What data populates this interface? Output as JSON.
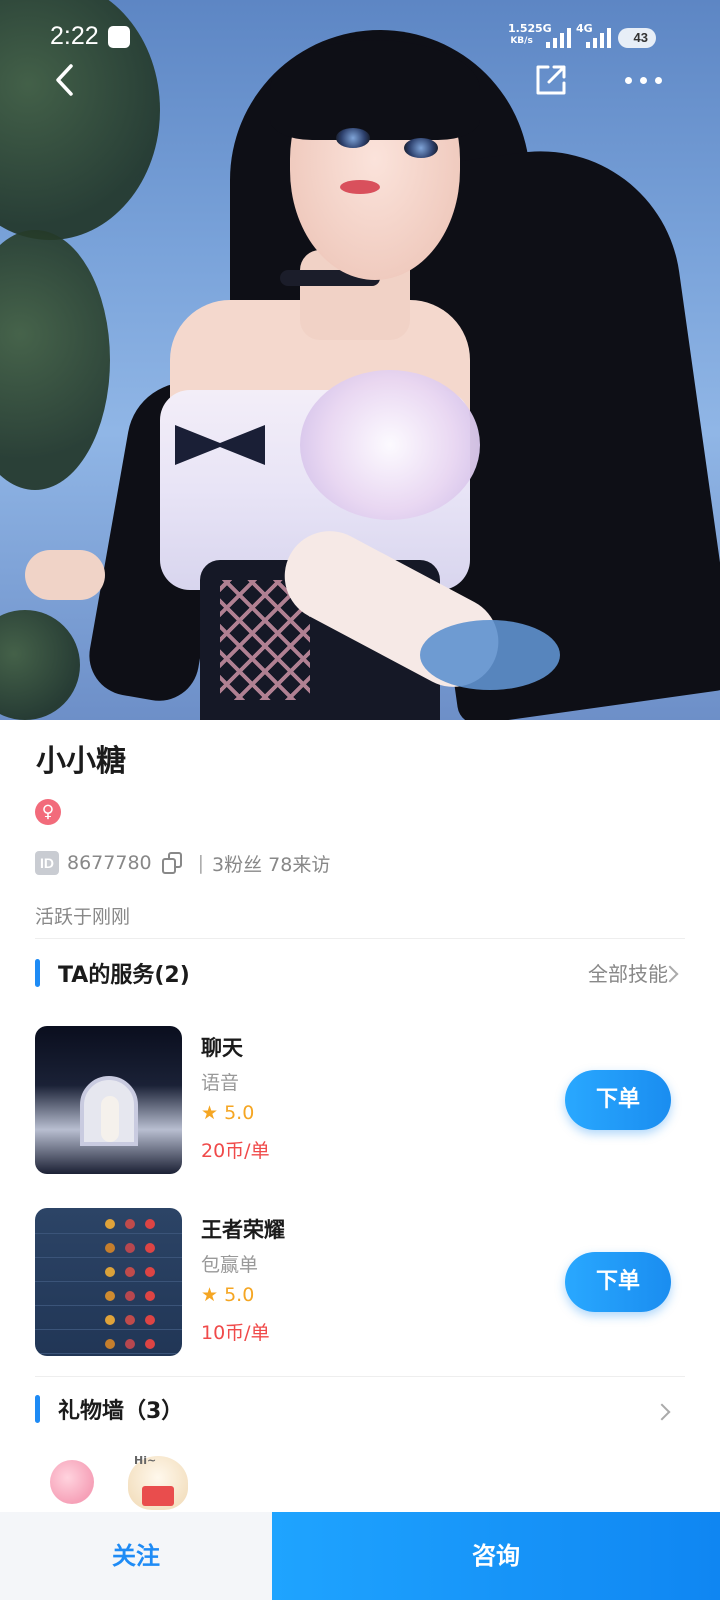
{
  "status_bar": {
    "time": "2:22",
    "net_speed_value": "1.52",
    "net_speed_unit": "KB/s",
    "sim1": "5G",
    "sim2": "4G",
    "battery": "43"
  },
  "profile": {
    "name": "小小糖",
    "gender_symbol": "♀",
    "id_badge": "ID",
    "id_number": "8677780",
    "fans_visits": "3粉丝 78来访",
    "separator": "|",
    "active_status": "活跃于刚刚"
  },
  "services": {
    "section_title": "TA的服务(2)",
    "more_label": "全部技能",
    "items": [
      {
        "title": "聊天",
        "subtitle": "语音",
        "rating": "5.0",
        "price": "20币/单",
        "order_label": "下单"
      },
      {
        "title": "王者荣耀",
        "subtitle": "包赢单",
        "rating": "5.0",
        "price": "10币/单",
        "order_label": "下单"
      }
    ]
  },
  "gifts": {
    "section_title": "礼物墙（3）",
    "sticker_text": "Hi~"
  },
  "bottom_bar": {
    "follow_label": "关注",
    "consult_label": "咨询"
  },
  "colors": {
    "accent": "#1e8bf5",
    "price": "#f04a4a",
    "rating": "#f5a623",
    "gender": "#f26b7b"
  },
  "icons": {
    "back": "back-arrow-icon",
    "share": "share-icon",
    "more": "more-dots-icon",
    "copy": "copy-icon",
    "star": "star-icon",
    "chevron": "chevron-right-icon"
  }
}
